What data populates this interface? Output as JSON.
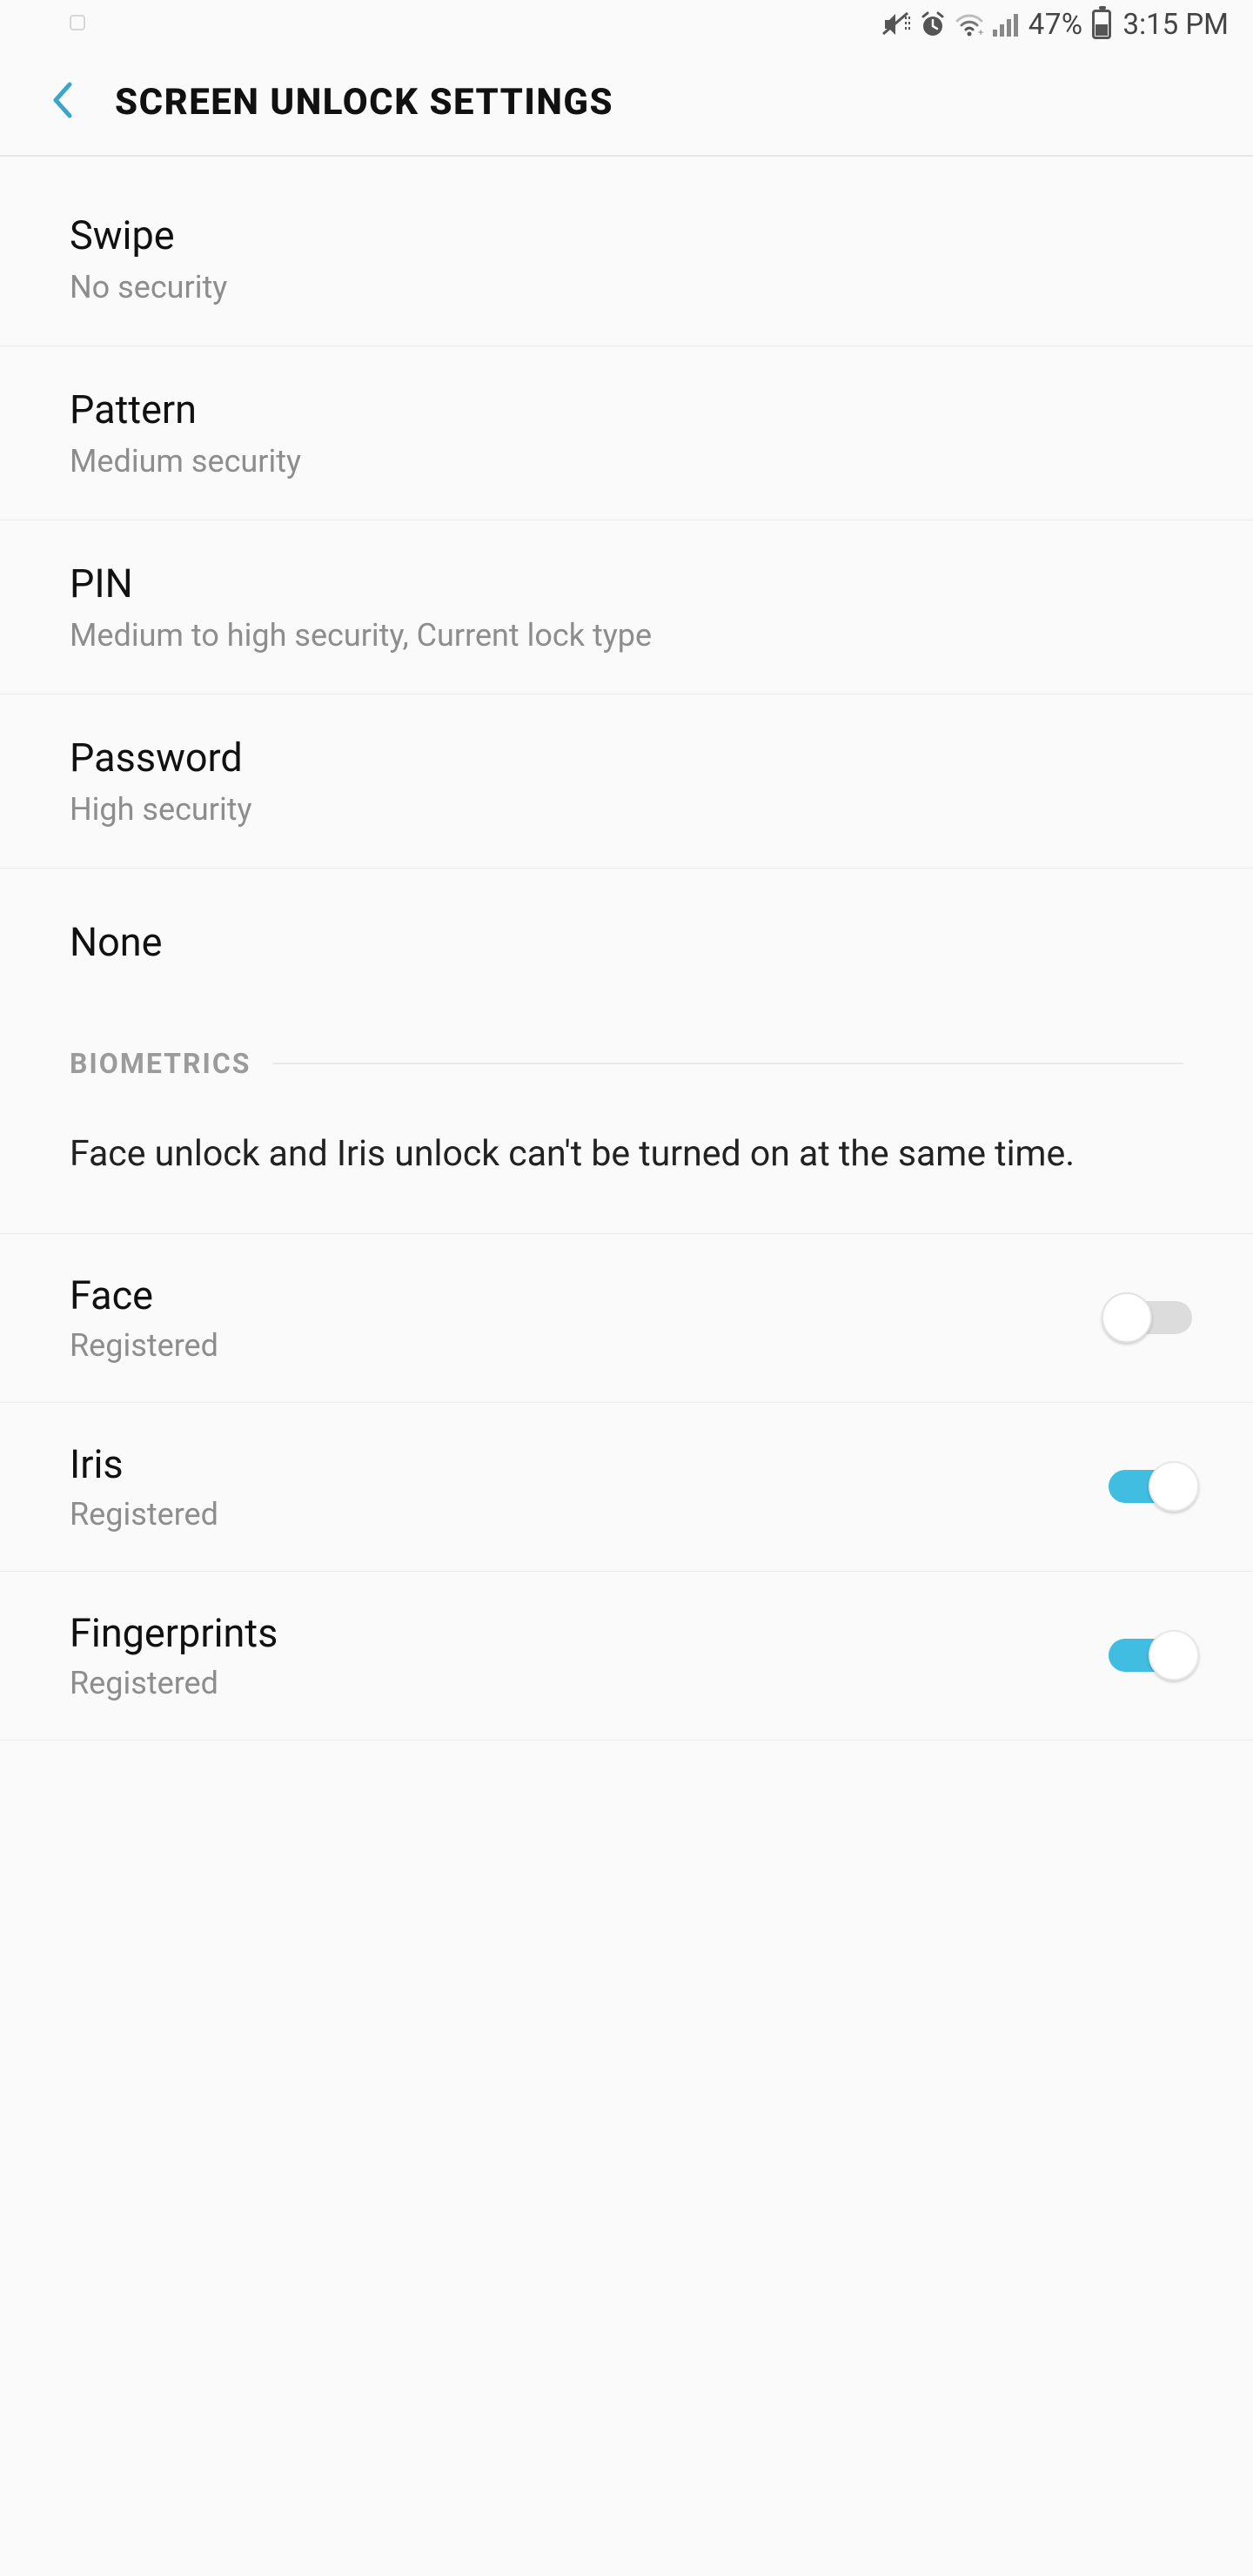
{
  "status": {
    "battery_pct": "47%",
    "time": "3:15 PM"
  },
  "header": {
    "title": "SCREEN UNLOCK SETTINGS"
  },
  "lock_types": [
    {
      "title": "Swipe",
      "sub": "No security"
    },
    {
      "title": "Pattern",
      "sub": "Medium security"
    },
    {
      "title": "PIN",
      "sub": "Medium to high security, Current lock type"
    },
    {
      "title": "Password",
      "sub": "High security"
    },
    {
      "title": "None",
      "sub": null
    }
  ],
  "biometrics": {
    "section_label": "BIOMETRICS",
    "note": "Face unlock and Iris unlock can't be turned on at the same time.",
    "items": [
      {
        "title": "Face",
        "sub": "Registered",
        "on": false
      },
      {
        "title": "Iris",
        "sub": "Registered",
        "on": true
      },
      {
        "title": "Fingerprints",
        "sub": "Registered",
        "on": true
      }
    ]
  }
}
